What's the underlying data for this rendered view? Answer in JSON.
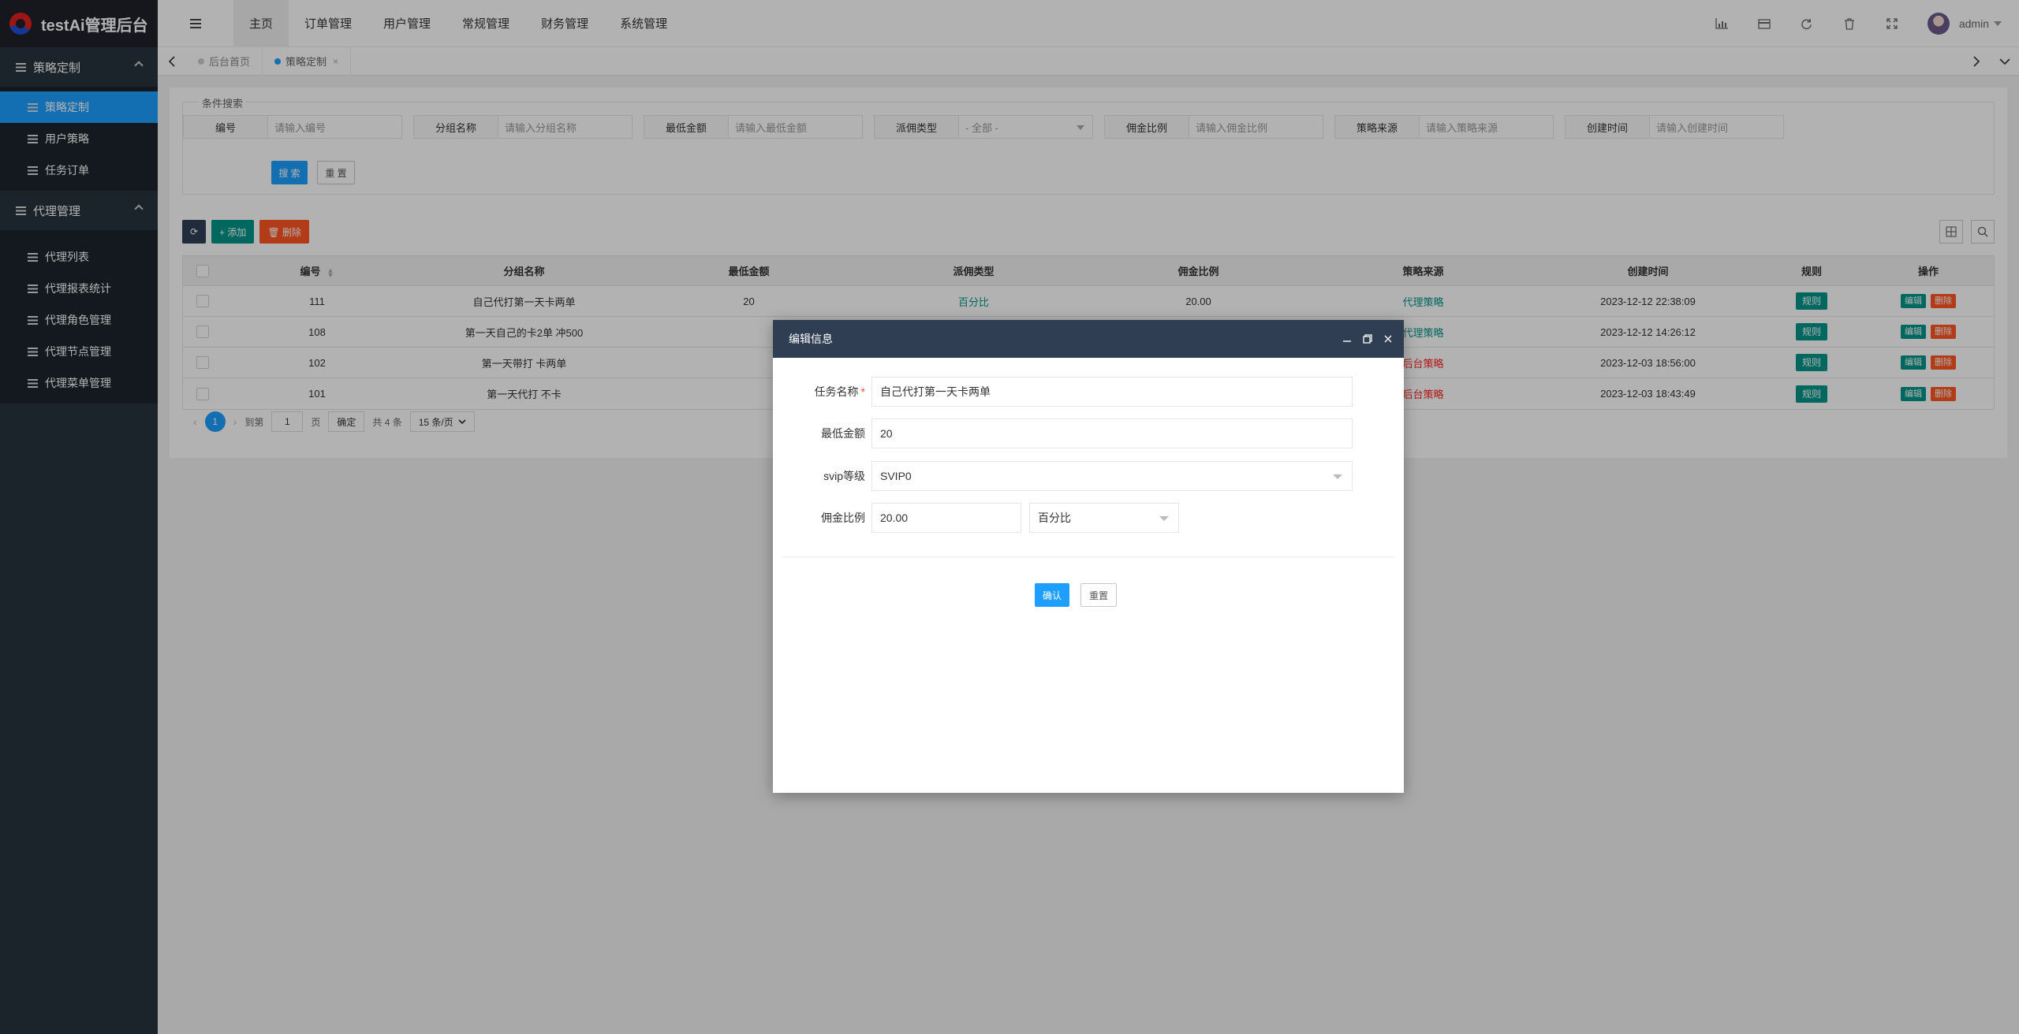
{
  "app": {
    "title": "testAi管理后台"
  },
  "sidebar": {
    "groups": [
      {
        "label": "策略定制",
        "items": [
          "策略定制",
          "用户策略",
          "任务订单"
        ]
      },
      {
        "label": "代理管理",
        "items": [
          "代理列表",
          "代理报表统计",
          "代理角色管理",
          "代理节点管理",
          "代理菜单管理"
        ]
      }
    ]
  },
  "header": {
    "nav": [
      "主页",
      "订单管理",
      "用户管理",
      "常规管理",
      "财务管理",
      "系统管理"
    ],
    "icons": [
      "chart-icon",
      "card-icon",
      "refresh-icon",
      "trash-icon",
      "fullscreen-icon"
    ],
    "user": "admin"
  },
  "tabs": {
    "items": [
      "后台首页",
      "策略定制"
    ],
    "close": "×"
  },
  "search": {
    "legend": "条件搜索",
    "fields": [
      {
        "label": "编号",
        "placeholder": "请输入编号"
      },
      {
        "label": "分组名称",
        "placeholder": "请输入分组名称"
      },
      {
        "label": "最低金额",
        "placeholder": "请输入最低金额"
      },
      {
        "label": "派佣类型",
        "placeholder": "- 全部 -"
      },
      {
        "label": "佣金比例",
        "placeholder": "请输入佣金比例"
      },
      {
        "label": "策略来源",
        "placeholder": "请输入策略来源"
      },
      {
        "label": "创建时间",
        "placeholder": "请输入创建时间"
      }
    ],
    "search_btn": "搜 索",
    "reset_btn": "重 置"
  },
  "toolbar": {
    "refresh": "⟳",
    "add": "+ 添加",
    "delete": "🗑 删除"
  },
  "table": {
    "headers": [
      "编号",
      "分组名称",
      "最低金额",
      "派佣类型",
      "佣金比例",
      "策略来源",
      "创建时间",
      "规则",
      "操作"
    ],
    "rows": [
      {
        "id": "111",
        "name": "自己代打第一天卡两单",
        "min": "20",
        "type": "百分比",
        "ratio": "20.00",
        "source": "代理策略",
        "source_color": "#009688",
        "time": "2023-12-12 22:38:09"
      },
      {
        "id": "108",
        "name": "第一天自己的卡2单 冲500",
        "min": "",
        "type": "",
        "ratio": "",
        "source": "代理策略",
        "source_color": "#009688",
        "time": "2023-12-12 14:26:12"
      },
      {
        "id": "102",
        "name": "第一天带打 卡两单",
        "min": "",
        "type": "",
        "ratio": "",
        "source": "后台策略",
        "source_color": "#ff2020",
        "time": "2023-12-03 18:56:00"
      },
      {
        "id": "101",
        "name": "第一天代打 不卡",
        "min": "",
        "type": "",
        "ratio": "",
        "source": "后台策略",
        "source_color": "#ff2020",
        "time": "2023-12-03 18:43:49"
      }
    ],
    "rule_btn": "规则",
    "edit_btn": "编辑",
    "del_btn": "删除"
  },
  "pager": {
    "current": "1",
    "goto": "到第",
    "page_input": "1",
    "page": "页",
    "confirm": "确定",
    "total": "共 4 条",
    "per_page": "15 条/页"
  },
  "modal": {
    "title": "编辑信息",
    "fields": {
      "name_label": "任务名称",
      "name_value": "自己代打第一天卡两单",
      "min_label": "最低金额",
      "min_value": "20",
      "svip_label": "svip等级",
      "svip_value": "SVIP0",
      "ratio_label": "佣金比例",
      "ratio_value": "20.00",
      "ratio_type": "百分比"
    },
    "confirm": "确认",
    "reset": "重置"
  }
}
